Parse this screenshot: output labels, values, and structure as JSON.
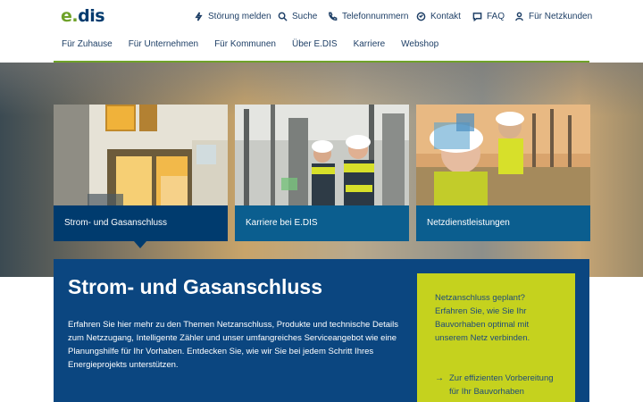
{
  "brand": {
    "logo_part1": "e.",
    "logo_part2": "dis"
  },
  "utility_nav": [
    {
      "label": "Störung melden",
      "icon": "bolt-icon"
    },
    {
      "label": "Suche",
      "icon": "search-icon"
    },
    {
      "label": "Telefonnummern",
      "icon": "phone-icon"
    },
    {
      "label": "Kontakt",
      "icon": "contact-icon"
    },
    {
      "label": "FAQ",
      "icon": "chat-icon"
    },
    {
      "label": "Für Netzkunden",
      "icon": "user-icon"
    }
  ],
  "main_nav": [
    "Für Zuhause",
    "Für Unternehmen",
    "Für Kommunen",
    "Über E.DIS",
    "Karriere",
    "Webshop"
  ],
  "cards": [
    {
      "label": "Strom- und Gasanschluss",
      "active": true
    },
    {
      "label": "Karriere bei E.DIS",
      "active": false
    },
    {
      "label": "Netzdienstleistungen",
      "active": false
    }
  ],
  "panel": {
    "title": "Strom- und Gasanschluss",
    "body": "Erfahren Sie hier mehr zu den Themen Netzanschluss, Produkte und technische Details zum Netzzugang, Intelligente Zähler und unser umfangreiches Serviceangebot wie eine Planungshilfe für Ihr Vorhaben. Entdecken Sie, wie wir Sie bei jedem Schritt Ihres Energieprojekts unterstützen."
  },
  "aside": {
    "text": "Netzanschluss geplant? Erfahren Sie, wie Sie Ihr Bauvorhaben optimal mit unserem Netz verbinden.",
    "link": "Zur effizienten Vorbereitung für Ihr Bauvorhaben"
  },
  "colors": {
    "green": "#6fa229",
    "navy": "#0b4680",
    "lime": "#c5d21e"
  }
}
